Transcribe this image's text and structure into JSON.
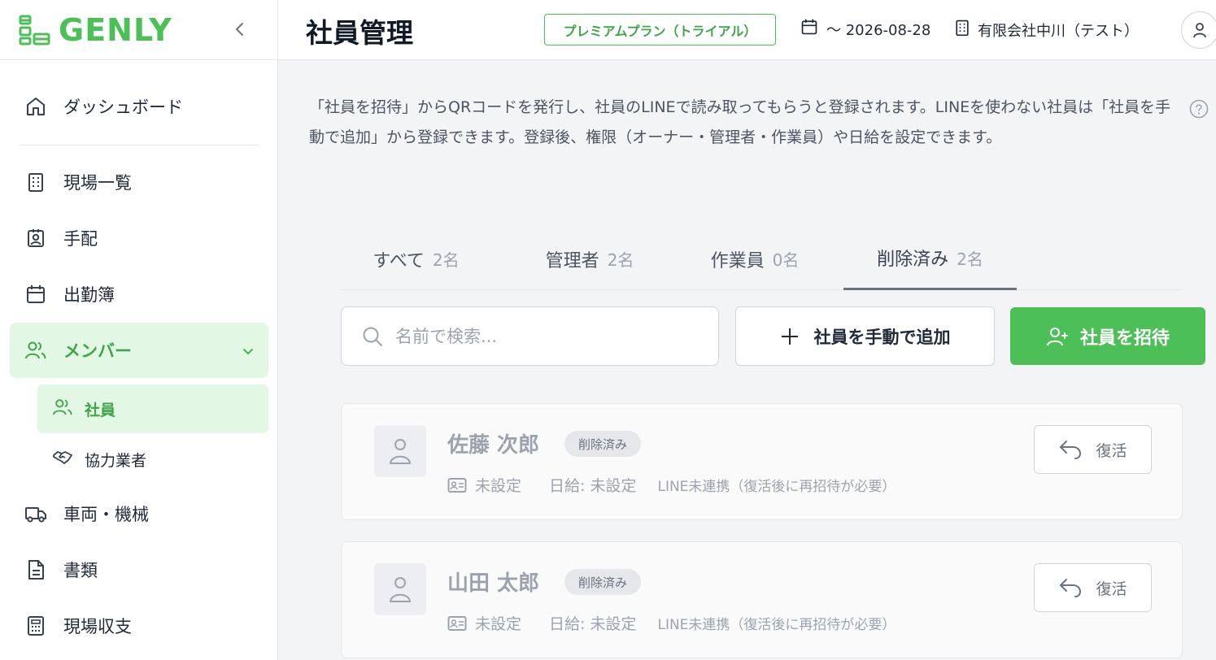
{
  "brand": {
    "name": "GENLY",
    "color": "#4cbf57"
  },
  "sidebar": {
    "items": [
      {
        "label": "ダッシュボード",
        "icon": "home-icon"
      },
      {
        "label": "現場一覧",
        "icon": "building-icon"
      },
      {
        "label": "手配",
        "icon": "id-badge-icon"
      },
      {
        "label": "出勤簿",
        "icon": "calendar-icon"
      },
      {
        "label": "メンバー",
        "icon": "users-icon",
        "active": true
      },
      {
        "label": "車両・機械",
        "icon": "truck-icon"
      },
      {
        "label": "書類",
        "icon": "document-icon"
      },
      {
        "label": "現場収支",
        "icon": "calculator-icon"
      }
    ],
    "subitems": [
      {
        "label": "社員",
        "icon": "users-icon",
        "active": true
      },
      {
        "label": "協力業者",
        "icon": "handshake-icon"
      }
    ]
  },
  "header": {
    "title": "社員管理",
    "plan": "プレミアムプラン（トライアル）",
    "date": "〜 2026-08-28",
    "company": "有限会社中川（テスト）"
  },
  "main": {
    "description": "「社員を招待」からQRコードを発行し、社員のLINEで読み取ってもらうと登録されます。LINEを使わない社員は「社員を手動で追加」から登録できます。登録後、権限（オーナー・管理者・作業員）や日給を設定できます。",
    "tabs": [
      {
        "label": "すべて",
        "count": "2名"
      },
      {
        "label": "管理者",
        "count": "2名"
      },
      {
        "label": "作業員",
        "count": "0名"
      },
      {
        "label": "削除済み",
        "count": "2名",
        "active": true
      }
    ],
    "search_placeholder": "名前で検索...",
    "add_button": "社員を手動で追加",
    "invite_button": "社員を招待",
    "employees": [
      {
        "name": "佐藤 次郎",
        "status": "削除済み",
        "role": "未設定",
        "wage": "日給: 未設定",
        "line": "LINE未連携（復活後に再招待が必要）",
        "restore": "復活"
      },
      {
        "name": "山田 太郎",
        "status": "削除済み",
        "role": "未設定",
        "wage": "日給: 未設定",
        "line": "LINE未連携（復活後に再招待が必要）",
        "restore": "復活"
      }
    ]
  }
}
